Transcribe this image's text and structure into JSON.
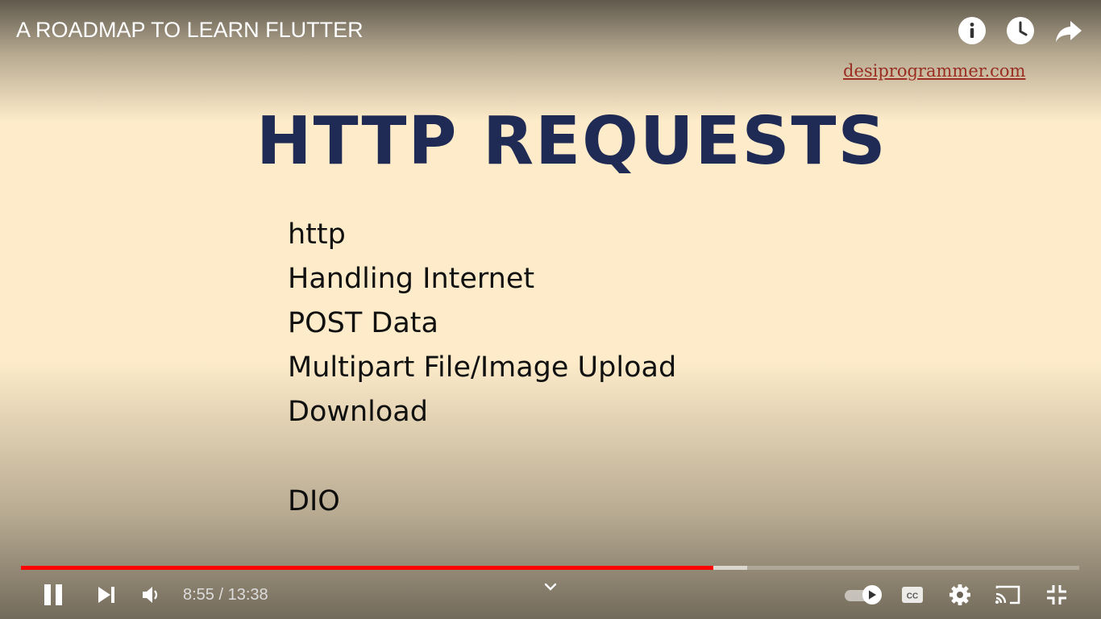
{
  "video": {
    "title": "A ROADMAP TO LEARN FLUTTER"
  },
  "top_actions": {
    "info_icon": "info-icon",
    "watch_later_icon": "clock-icon",
    "share_icon": "share-icon"
  },
  "slide": {
    "watermark": "desiprogrammer.com",
    "heading": "HTTP REQUESTS",
    "topics": [
      "http",
      "Handling Internet",
      "POST Data",
      "Multipart File/Image Upload",
      "Download",
      "DIO"
    ]
  },
  "playback": {
    "current_time": "8:55",
    "separator": "/",
    "duration": "13:38",
    "time_display": "8:55 / 13:38",
    "played_fraction": 0.654,
    "buffered_fraction": 0.686
  },
  "colors": {
    "slide_background": "#fdebc9",
    "heading": "#1f2a55",
    "watermark": "#c0392b",
    "progress_played": "#ff0000"
  }
}
